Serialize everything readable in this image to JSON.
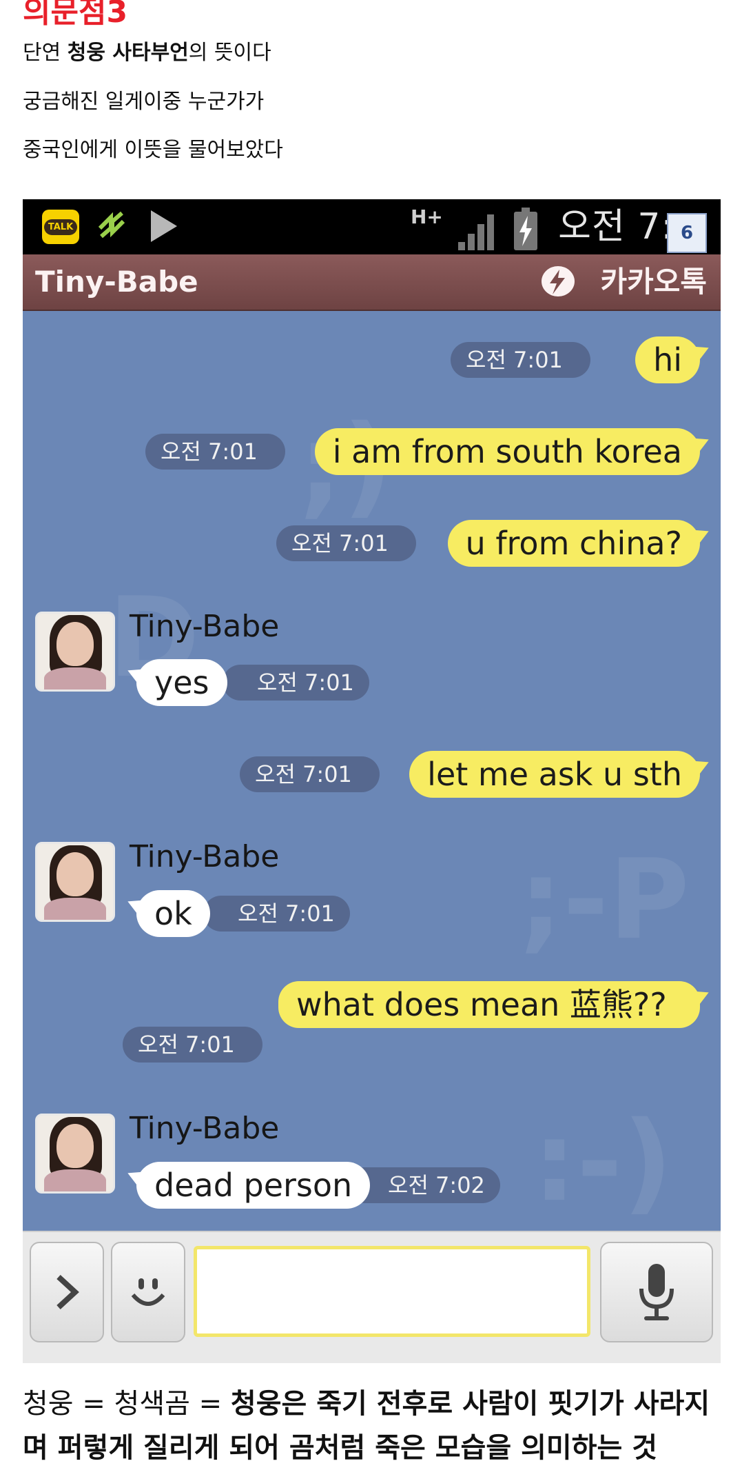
{
  "heading": "의문점3",
  "paragraphs": {
    "p1_pre": "단연 ",
    "p1_bold": "청웅 사타부언",
    "p1_post": "의 뜻이다",
    "p2": "궁금해진 일게이중 누군가가",
    "p3": "중국인에게 이뜻을 물어보았다"
  },
  "status_bar": {
    "app_icon_label": "TALK",
    "network": "H+",
    "clock": "오전 7:",
    "badge": "6",
    "icons": [
      "kakaotalk-icon",
      "sync-arrows-icon",
      "play-icon",
      "network-hplus-icon",
      "signal-icon",
      "battery-charging-icon"
    ]
  },
  "title_bar": {
    "contact_name": "Tiny-Babe",
    "app_name": "카카오톡"
  },
  "messages": [
    {
      "from": "me",
      "text": "hi",
      "time": "오전 7:01"
    },
    {
      "from": "me",
      "text": "i am from south korea",
      "time": "오전 7:01"
    },
    {
      "from": "me",
      "text": "u from china?",
      "time": "오전 7:01"
    },
    {
      "from": "them",
      "sender": "Tiny-Babe",
      "text": "yes",
      "time": "오전 7:01"
    },
    {
      "from": "me",
      "text": "let me ask u sth",
      "time": "오전 7:01"
    },
    {
      "from": "them",
      "sender": "Tiny-Babe",
      "text": "ok",
      "time": "오전 7:01"
    },
    {
      "from": "me",
      "text": "what does mean 蓝熊??",
      "time": "오전 7:01"
    },
    {
      "from": "them",
      "sender": "Tiny-Babe",
      "text": "dead person",
      "time": "오전 7:02"
    }
  ],
  "input_bar": {
    "placeholder": "",
    "icons": [
      "expand-arrow-icon",
      "emoticon-icon",
      "microphone-icon"
    ]
  },
  "footer": {
    "plain": "청웅 = 청색곰 = ",
    "bold": "청웅은 죽기 전후로 사람이 핏기가 사라지며 퍼렇게 질리게 되어 곰처럼 죽은 모습을 의미하는 것"
  },
  "colors": {
    "heading": "#e8202a",
    "chat_bg": "#6b87b6",
    "my_bubble": "#f7ec62",
    "their_bubble": "#ffffff",
    "title_bar": "#7a4a4a"
  }
}
